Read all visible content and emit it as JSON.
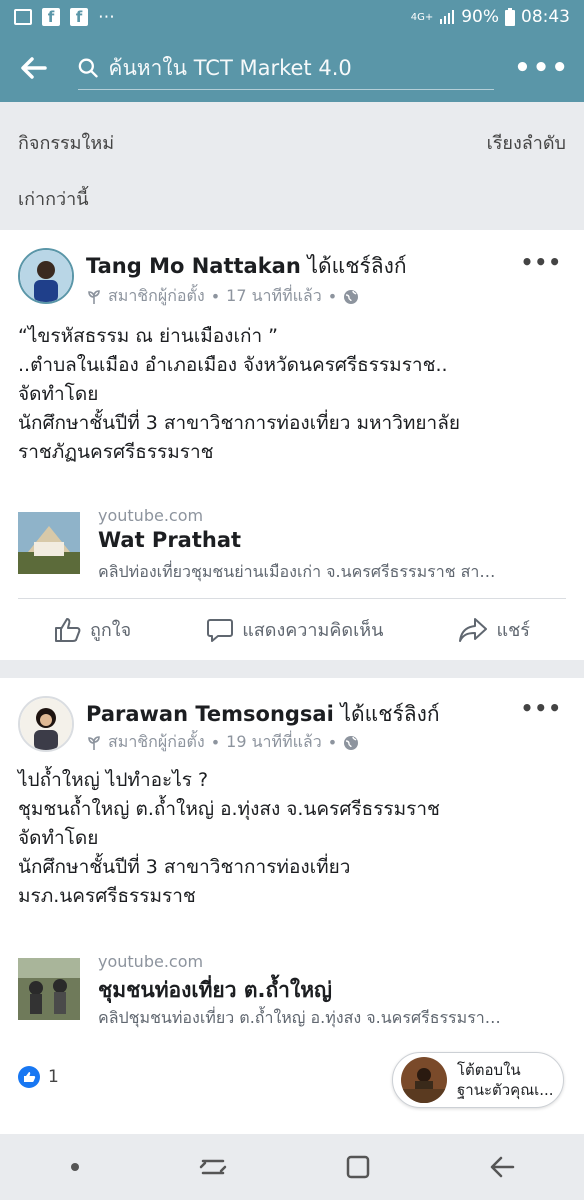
{
  "status": {
    "signal": "4G+",
    "battery": "90%",
    "time": "08:43",
    "notif_more": "⋯"
  },
  "search": {
    "placeholder": "ค้นหาใน TCT Market 4.0"
  },
  "filter": {
    "new_activity": "กิจกรรมใหม่",
    "sort": "เรียงลำดับ",
    "older": "เก่ากว่านี้"
  },
  "posts": [
    {
      "author": "Tang Mo Nattakan",
      "verb": " ได้แชร์ลิงก์",
      "role": "สมาชิกผู้ก่อตั้ง",
      "time": "17 นาทีที่แล้ว",
      "body": [
        "“ไขรหัสธรรม ณ ย่านเมืองเก่า ”",
        "..ตำบลในเมือง อำเภอเมือง จังหวัดนครศรีธรรมราช..",
        "จัดทำโดย",
        "นักศึกษาชั้นปีที่ 3 สาขาวิชาการท่องเที่ยว มหาวิทยาลัย",
        "ราชภัฏนครศรีธรรมราช"
      ],
      "link": {
        "domain": "youtube.com",
        "title": "Wat Prathat",
        "desc": "คลิปท่องเที่ยวชุมชนย่านเมืองเก่า จ.นครศรีธรรมราช สา…"
      },
      "actions": {
        "like": "ถูกใจ",
        "comment": "แสดงความคิดเห็น",
        "share": "แชร์"
      }
    },
    {
      "author": "Parawan Temsongsai",
      "verb": " ได้แชร์ลิงก์",
      "role": "สมาชิกผู้ก่อตั้ง",
      "time": "19 นาทีที่แล้ว",
      "body": [
        "ไปถ้ำใหญ่ ไปทำอะไร ?",
        "ชุมชนถ้ำใหญ่ ต.ถ้ำใหญ่ อ.ทุ่งสง จ.นครศรีธรรมราช",
        "จัดทำโดย",
        "นักศึกษาชั้นปีที่ 3 สาขาวิชาการท่องเที่ยว",
        "มรภ.นครศรีธรรมราช"
      ],
      "link": {
        "domain": "youtube.com",
        "title": "ชุมชนท่องเที่ยว ต.ถ้ำใหญ่",
        "desc": "คลิปชุมชนท่องเที่ยว ต.ถ้ำใหญ่ อ.ทุ่งสง จ.นครศรีธรรมรา…"
      },
      "likes": "1"
    }
  ],
  "reply_chip": {
    "line1": "โต้ตอบใน",
    "line2": "ฐานะตัวคุณเ..."
  },
  "colors": {
    "header": "#5a96a8",
    "like_blue": "#1877f2"
  }
}
